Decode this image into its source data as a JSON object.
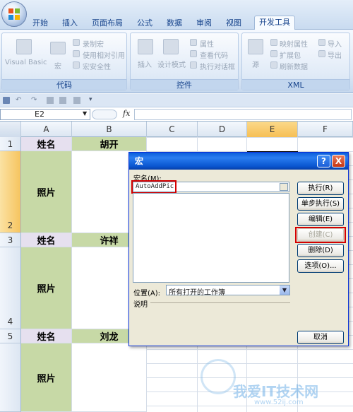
{
  "ribbon": {
    "tabs": [
      "开始",
      "插入",
      "页面布局",
      "公式",
      "数据",
      "审阅",
      "视图",
      "开发工具"
    ],
    "active_tab": "开发工具",
    "groups": {
      "code": {
        "label": "代码",
        "visual_basic": "Visual Basic",
        "macros": "宏",
        "record_macro": "录制宏",
        "relative_ref": "使用相对引用",
        "macro_security": "宏安全性"
      },
      "controls": {
        "label": "控件",
        "insert": "插入",
        "design_mode": "设计模式",
        "properties": "属性",
        "view_code": "查看代码",
        "run_dialog": "执行对话框"
      },
      "xml": {
        "label": "XML",
        "source": "源",
        "map_properties": "映射属性",
        "expansion_packs": "扩展包",
        "refresh_data": "刷新数据",
        "import": "导入",
        "export": "导出"
      }
    }
  },
  "formula_bar": {
    "name_box": "E2",
    "fx": "fx",
    "formula": ""
  },
  "sheet": {
    "columns": [
      "A",
      "B",
      "C",
      "D",
      "E",
      "F"
    ],
    "selected_column": "E",
    "rows": [
      "1",
      "2",
      "3",
      "4",
      "5"
    ],
    "selected_row": "2",
    "cells": {
      "a1": "姓名",
      "b1": "胡开",
      "a2": "照片",
      "a3": "姓名",
      "b3": "许祥",
      "a4": "照片",
      "a5": "姓名",
      "b5": "刘龙",
      "a6": "照片"
    }
  },
  "dialog": {
    "title": "宏",
    "help": "?",
    "close": "X",
    "macro_name_label": "宏名(M):",
    "macro_name_value": "AutoAddPic",
    "buttons": {
      "run": "执行(R)",
      "step_into": "单步执行(S)",
      "edit": "编辑(E)",
      "create": "创建(C)",
      "delete": "删除(D)",
      "options": "选项(O)...",
      "cancel": "取消"
    },
    "location_label": "位置(A):",
    "location_value": "所有打开的工作簿",
    "description_label": "说明"
  },
  "watermark": {
    "text": "我爱IT技术网",
    "url": "www.52ij.com"
  },
  "colors": {
    "highlight_red": "#d40000",
    "lavender": "#e6e0ef",
    "green": "#c7d9a6",
    "title_blue": "#0a5ddb"
  }
}
